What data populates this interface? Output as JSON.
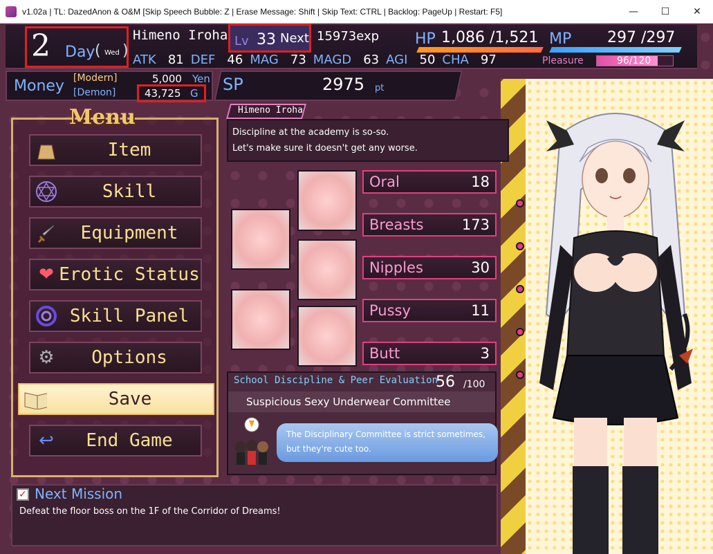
{
  "window": {
    "title": "v1.02a | TL: DazedAnon & O&M [Skip Speech Bubble: Z | Erase Message: Shift | Skip Text: CTRL | Backlog: PageUp | Restart: F5]",
    "minimize": "—",
    "maximize": "☐",
    "close": "✕"
  },
  "status": {
    "day_number": "2",
    "day_label": "Day",
    "weekday": "Wed",
    "paren_open": "(",
    "paren_close": ")",
    "character_name": "Himeno Iroha",
    "level_label": "Lv",
    "level": "33",
    "next_label": "Next",
    "next_exp": "15973exp",
    "hp_label": "HP",
    "hp": "1,086 /1,521",
    "hp_fraction": 0.714,
    "mp_label": "MP",
    "mp": "297 /297",
    "mp_fraction": 1.0,
    "pleasure_label": "Pleasure",
    "pleasure": "96/120",
    "pleasure_fraction": 0.8,
    "stats": [
      {
        "label": "ATK",
        "value": "81"
      },
      {
        "label": "DEF",
        "value": "46"
      },
      {
        "label": "MAG",
        "value": "73"
      },
      {
        "label": "MAGD",
        "value": "63"
      },
      {
        "label": "AGI",
        "value": "50"
      },
      {
        "label": "CHA",
        "value": "97"
      }
    ]
  },
  "money": {
    "label": "Money",
    "modern_label": "[Modern]",
    "demon_label": "[Demon]",
    "yen": "5,000",
    "yen_unit": "Yen",
    "gold": "43,725",
    "gold_unit": "G"
  },
  "sp": {
    "label": "SP",
    "value": "2975",
    "unit": "pt"
  },
  "menu": {
    "title": "Menu",
    "items": [
      {
        "label": "Item",
        "icon": "bag-icon"
      },
      {
        "label": "Skill",
        "icon": "hexagram-icon"
      },
      {
        "label": "Equipment",
        "icon": "sword-icon"
      },
      {
        "label": "Erotic Status",
        "icon": "heart-icon"
      },
      {
        "label": "Skill Panel",
        "icon": "swirl-icon"
      },
      {
        "label": "Options",
        "icon": "gear-icon"
      },
      {
        "label": "Save",
        "icon": "book-icon"
      },
      {
        "label": "End Game",
        "icon": "return-arrow-icon"
      }
    ]
  },
  "dialogue": {
    "speaker": "Himeno Iroha",
    "line1": "Discipline at the academy is so-so.",
    "line2": "Let's make sure it doesn't get any worse."
  },
  "body_stats": [
    {
      "label": "Oral",
      "value": "18"
    },
    {
      "label": "Breasts",
      "value": "173"
    },
    {
      "label": "Nipples",
      "value": "30"
    },
    {
      "label": "Pussy",
      "value": "11"
    },
    {
      "label": "Butt",
      "value": "3"
    }
  ],
  "discipline": {
    "title": "School Discipline & Peer Evaluation",
    "score": "56",
    "max": "/100",
    "committee": "Suspicious Sexy Underwear Committee",
    "comment1": "The Disciplinary Committee is strict sometimes,",
    "comment2": "but they're cute too."
  },
  "mission": {
    "checkbox": "✓",
    "title": "Next Mission",
    "description": "Defeat the floor boss on the 1F of the Corridor of Dreams!"
  },
  "colors": {
    "accent_blue": "#7fb4ff",
    "pink": "#ff9ad0",
    "gold": "#f8e090",
    "highlight_red": "#e02020"
  }
}
